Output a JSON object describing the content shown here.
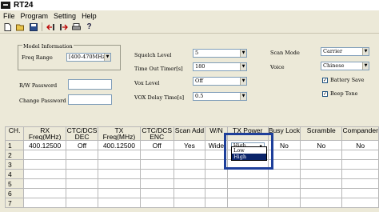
{
  "app": {
    "icon": "RT24 app icon",
    "title": "RT24"
  },
  "menu": [
    "File",
    "Program",
    "Setting",
    "Help"
  ],
  "toolbar": {
    "icons": [
      "new-file-icon",
      "open-file-icon",
      "save-icon",
      "read-from-radio-icon",
      "write-to-radio-icon",
      "print-icon",
      "help-icon"
    ]
  },
  "model": {
    "group_title": "Model Information",
    "freq_label": "Freq Range",
    "freq_value": "[400-470MHz]"
  },
  "passwords": {
    "rw_label": "R/W Password",
    "rw_value": "",
    "change_label": "Change Password",
    "change_value": ""
  },
  "settings": {
    "squelch_label": "Squelch Level",
    "squelch_value": "5",
    "tot_label": "Time Out Timer[s]",
    "tot_value": "180",
    "vox_label": "Vox Level",
    "vox_value": "Off",
    "vox_delay_label": "VOX Delay Time[s]",
    "vox_delay_value": "0.5",
    "scan_mode_label": "Scan Mode",
    "scan_mode_value": "Carrier",
    "voice_label": "Voice",
    "voice_value": "Chinese",
    "battery_label": "Battery Save",
    "battery_checked": true,
    "beep_label": "Beep Tone",
    "beep_checked": true
  },
  "table": {
    "headers": [
      "CH.",
      "RX\nFreq(MHz)",
      "CTC/DCS\nDEC",
      "TX\nFreq(MHz)",
      "CTC/DCS\nENC",
      "Scan Add",
      "W/N",
      "TX Power",
      "Busy Lock",
      "Scramble",
      "Compander"
    ],
    "header_top": [
      "CH.",
      "RX",
      "CTC/DCS",
      "TX",
      "CTC/DCS",
      "Scan Add",
      "W/N",
      "TX Power",
      "Busy Lock",
      "Scramble",
      "Compander"
    ],
    "header_bottom": [
      "",
      "Freq(MHz)",
      "DEC",
      "Freq(MHz)",
      "ENC",
      "",
      "",
      "",
      "",
      "",
      ""
    ],
    "row1": {
      "ch": "1",
      "rx": "400.12500",
      "dec": "Off",
      "tx": "400.12500",
      "enc": "Off",
      "scan": "Yes",
      "wn": "Wide",
      "power": "High",
      "busy": "No",
      "scramble": "No",
      "compander": "No"
    },
    "empty_rows": [
      "2",
      "3",
      "4",
      "5",
      "6",
      "7"
    ]
  },
  "power_dropdown": {
    "options": [
      "Low",
      "High"
    ],
    "selected": "High"
  },
  "highlight_color": "#1e3f9a"
}
